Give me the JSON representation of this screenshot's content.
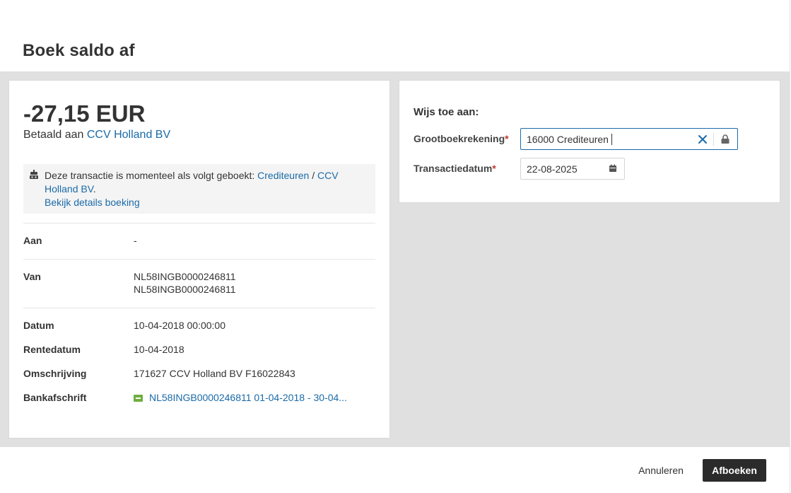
{
  "dialog": {
    "title": "Boek saldo af"
  },
  "transaction": {
    "amount": "-27,15 EUR",
    "paid_to_prefix": "Betaald aan ",
    "paid_to_name": "CCV Holland BV"
  },
  "notice": {
    "text": "Deze transactie is momenteel als volgt geboekt: ",
    "account_link": "Crediteuren",
    "separator": " / ",
    "counterparty_link": "CCV Holland BV",
    "period": ".",
    "details_link": "Bekijk details boeking"
  },
  "details": {
    "to": {
      "label": "Aan",
      "value": "-"
    },
    "from": {
      "label": "Van",
      "value_line1": "NL58INGB0000246811",
      "value_line2": "NL58INGB0000246811"
    },
    "date": {
      "label": "Datum",
      "value": "10-04-2018 00:00:00"
    },
    "interest_date": {
      "label": "Rentedatum",
      "value": "10-04-2018"
    },
    "description": {
      "label": "Omschrijving",
      "value": "171627 CCV Holland BV F16022843"
    },
    "statement": {
      "label": "Bankafschrift",
      "value": "NL58INGB0000246811 01-04-2018 - 30-04..."
    }
  },
  "assign": {
    "title": "Wijs toe aan:",
    "ledger_label": "Grootboekrekening",
    "ledger_value": "16000 Crediteuren",
    "date_label": "Transactiedatum",
    "date_value": "22-08-2025",
    "required_mark": "*"
  },
  "footer": {
    "cancel_label": "Annuleren",
    "submit_label": "Afboeken"
  },
  "colors": {
    "link": "#1a6aa8",
    "primary_button": "#2b2b2b",
    "body_background": "#e0e0e0",
    "required": "#c0392b",
    "statement_icon": "#6fae3f"
  },
  "icons": {
    "notice": "robot-icon",
    "clear": "close-icon",
    "lock": "lock-icon",
    "calendar": "calendar-icon",
    "statement": "bank-statement-icon"
  }
}
